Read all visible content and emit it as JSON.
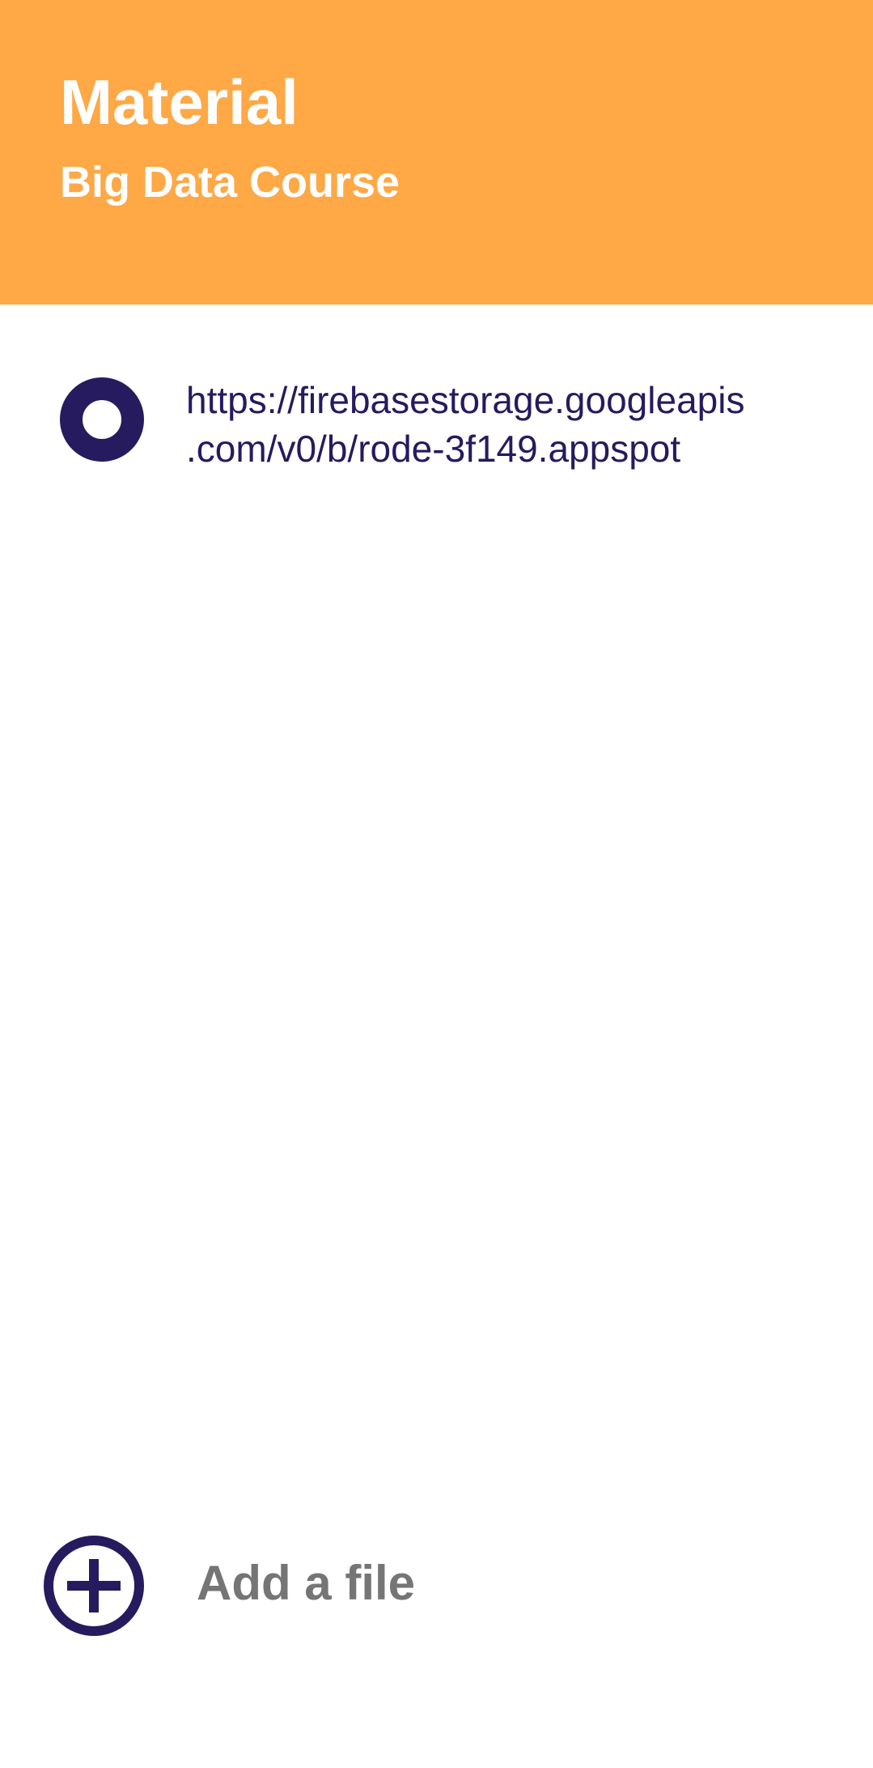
{
  "header": {
    "title": "Material",
    "subtitle": "Big Data Course",
    "background_color": "#FEA846"
  },
  "files": [
    {
      "icon": "radio-circle-icon",
      "url_line1": "https://firebasestorage.googleapis",
      "url_line2": ".com/v0/b/rode-3f149.appspot"
    }
  ],
  "add_file": {
    "icon": "add-circle-icon",
    "label": "Add a file"
  },
  "colors": {
    "accent": "#251B5E",
    "label_gray": "#757575"
  }
}
